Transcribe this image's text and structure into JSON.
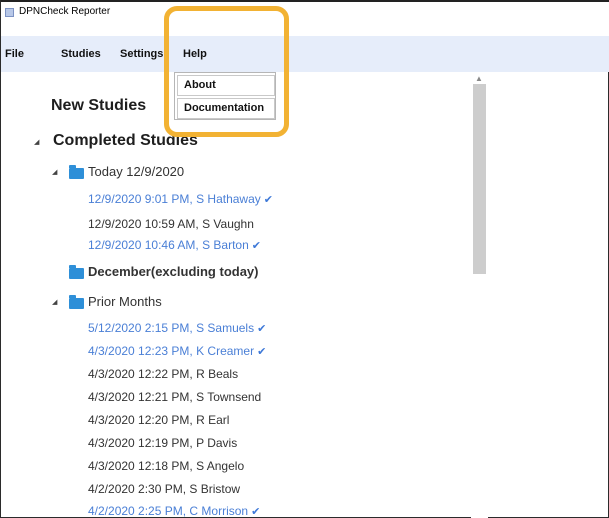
{
  "window": {
    "title": "DPNCheck Reporter"
  },
  "menu": {
    "file": "File",
    "studies": "Studies",
    "settings": "Settings",
    "help": "Help"
  },
  "help_menu": {
    "about": "About",
    "documentation": "Documentation"
  },
  "tree": {
    "new_studies": "New Studies",
    "completed_studies": "Completed Studies",
    "today": {
      "label": "Today 12/9/2020",
      "items": [
        {
          "text": "12/9/2020 9:01 PM, S Hathaway",
          "reviewed": true
        },
        {
          "text": "12/9/2020 10:59 AM, S Vaughn",
          "reviewed": false
        },
        {
          "text": "12/9/2020 10:46 AM, S Barton",
          "reviewed": true
        }
      ]
    },
    "december": {
      "label": "December(excluding today)"
    },
    "prior": {
      "label": "Prior Months",
      "items": [
        {
          "text": "5/12/2020 2:15 PM, S Samuels",
          "reviewed": true
        },
        {
          "text": "4/3/2020 12:23 PM, K Creamer",
          "reviewed": true
        },
        {
          "text": "4/3/2020 12:22 PM, R Beals",
          "reviewed": false
        },
        {
          "text": "4/3/2020 12:21 PM, S Townsend",
          "reviewed": false
        },
        {
          "text": "4/3/2020 12:20 PM, R Earl",
          "reviewed": false
        },
        {
          "text": "4/3/2020 12:19 PM, P Davis",
          "reviewed": false
        },
        {
          "text": "4/3/2020 12:18 PM, S Angelo",
          "reviewed": false
        },
        {
          "text": "4/2/2020 2:30 PM, S Bristow",
          "reviewed": false
        },
        {
          "text": "4/2/2020 2:25 PM, C Morrison",
          "reviewed": true
        }
      ]
    }
  },
  "colors": {
    "highlight_outline": "#f2b233",
    "reviewed_text": "#4a7fd6",
    "folder": "#2e8fd8",
    "menubar": "#e6edfa"
  }
}
